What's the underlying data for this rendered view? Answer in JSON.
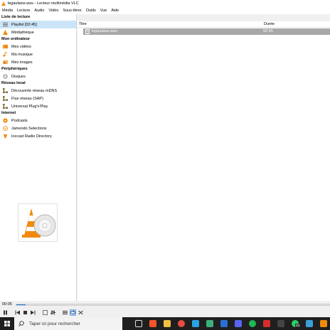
{
  "window": {
    "title": "legaulaise.wav - Lecteur multimédia VLC"
  },
  "menu": [
    "Média",
    "Lecture",
    "Audio",
    "Vidéo",
    "Sous-titres",
    "Outils",
    "Vue",
    "Aide"
  ],
  "sidebar": {
    "sections": [
      {
        "title": "Liste de lecture",
        "items": [
          {
            "label": "Playlist [02:45]",
            "icon": "playlist-icon",
            "selected": true
          },
          {
            "label": "Médiathèque",
            "icon": "library-icon"
          }
        ]
      },
      {
        "title": "Mon ordinateur",
        "items": [
          {
            "label": "Mes vidéos",
            "icon": "videos-icon"
          },
          {
            "label": "Ma musique",
            "icon": "music-icon"
          },
          {
            "label": "Mes images",
            "icon": "images-icon"
          }
        ]
      },
      {
        "title": "Périphériques",
        "items": [
          {
            "label": "Disques",
            "icon": "disc-icon"
          }
        ]
      },
      {
        "title": "Réseau local",
        "items": [
          {
            "label": "Découverte réseau mDNS",
            "icon": "network-icon"
          },
          {
            "label": "Flux réseau (SAP)",
            "icon": "network-icon"
          },
          {
            "label": "Universal Plug'n'Play",
            "icon": "network-icon"
          }
        ]
      },
      {
        "title": "Internet",
        "items": [
          {
            "label": "Podcasts",
            "icon": "podcast-icon"
          },
          {
            "label": "Jamendo Selections",
            "icon": "jamendo-icon"
          },
          {
            "label": "Icecast Radio Directory",
            "icon": "icecast-icon"
          }
        ]
      }
    ]
  },
  "playlist": {
    "columns": {
      "title": "Titre",
      "duration": "Durée"
    },
    "rows": [
      {
        "title": "legaulaise.wav",
        "duration": "02:45"
      }
    ]
  },
  "player": {
    "elapsed": "00:05",
    "progress": 0.03
  },
  "taskbar": {
    "search_placeholder": "Taper ici pour rechercher",
    "badge": "24"
  },
  "colors": {
    "accent": "#cce4f7",
    "vlc_orange": "#f08a0c",
    "taskbar": "#1f1f1f"
  }
}
